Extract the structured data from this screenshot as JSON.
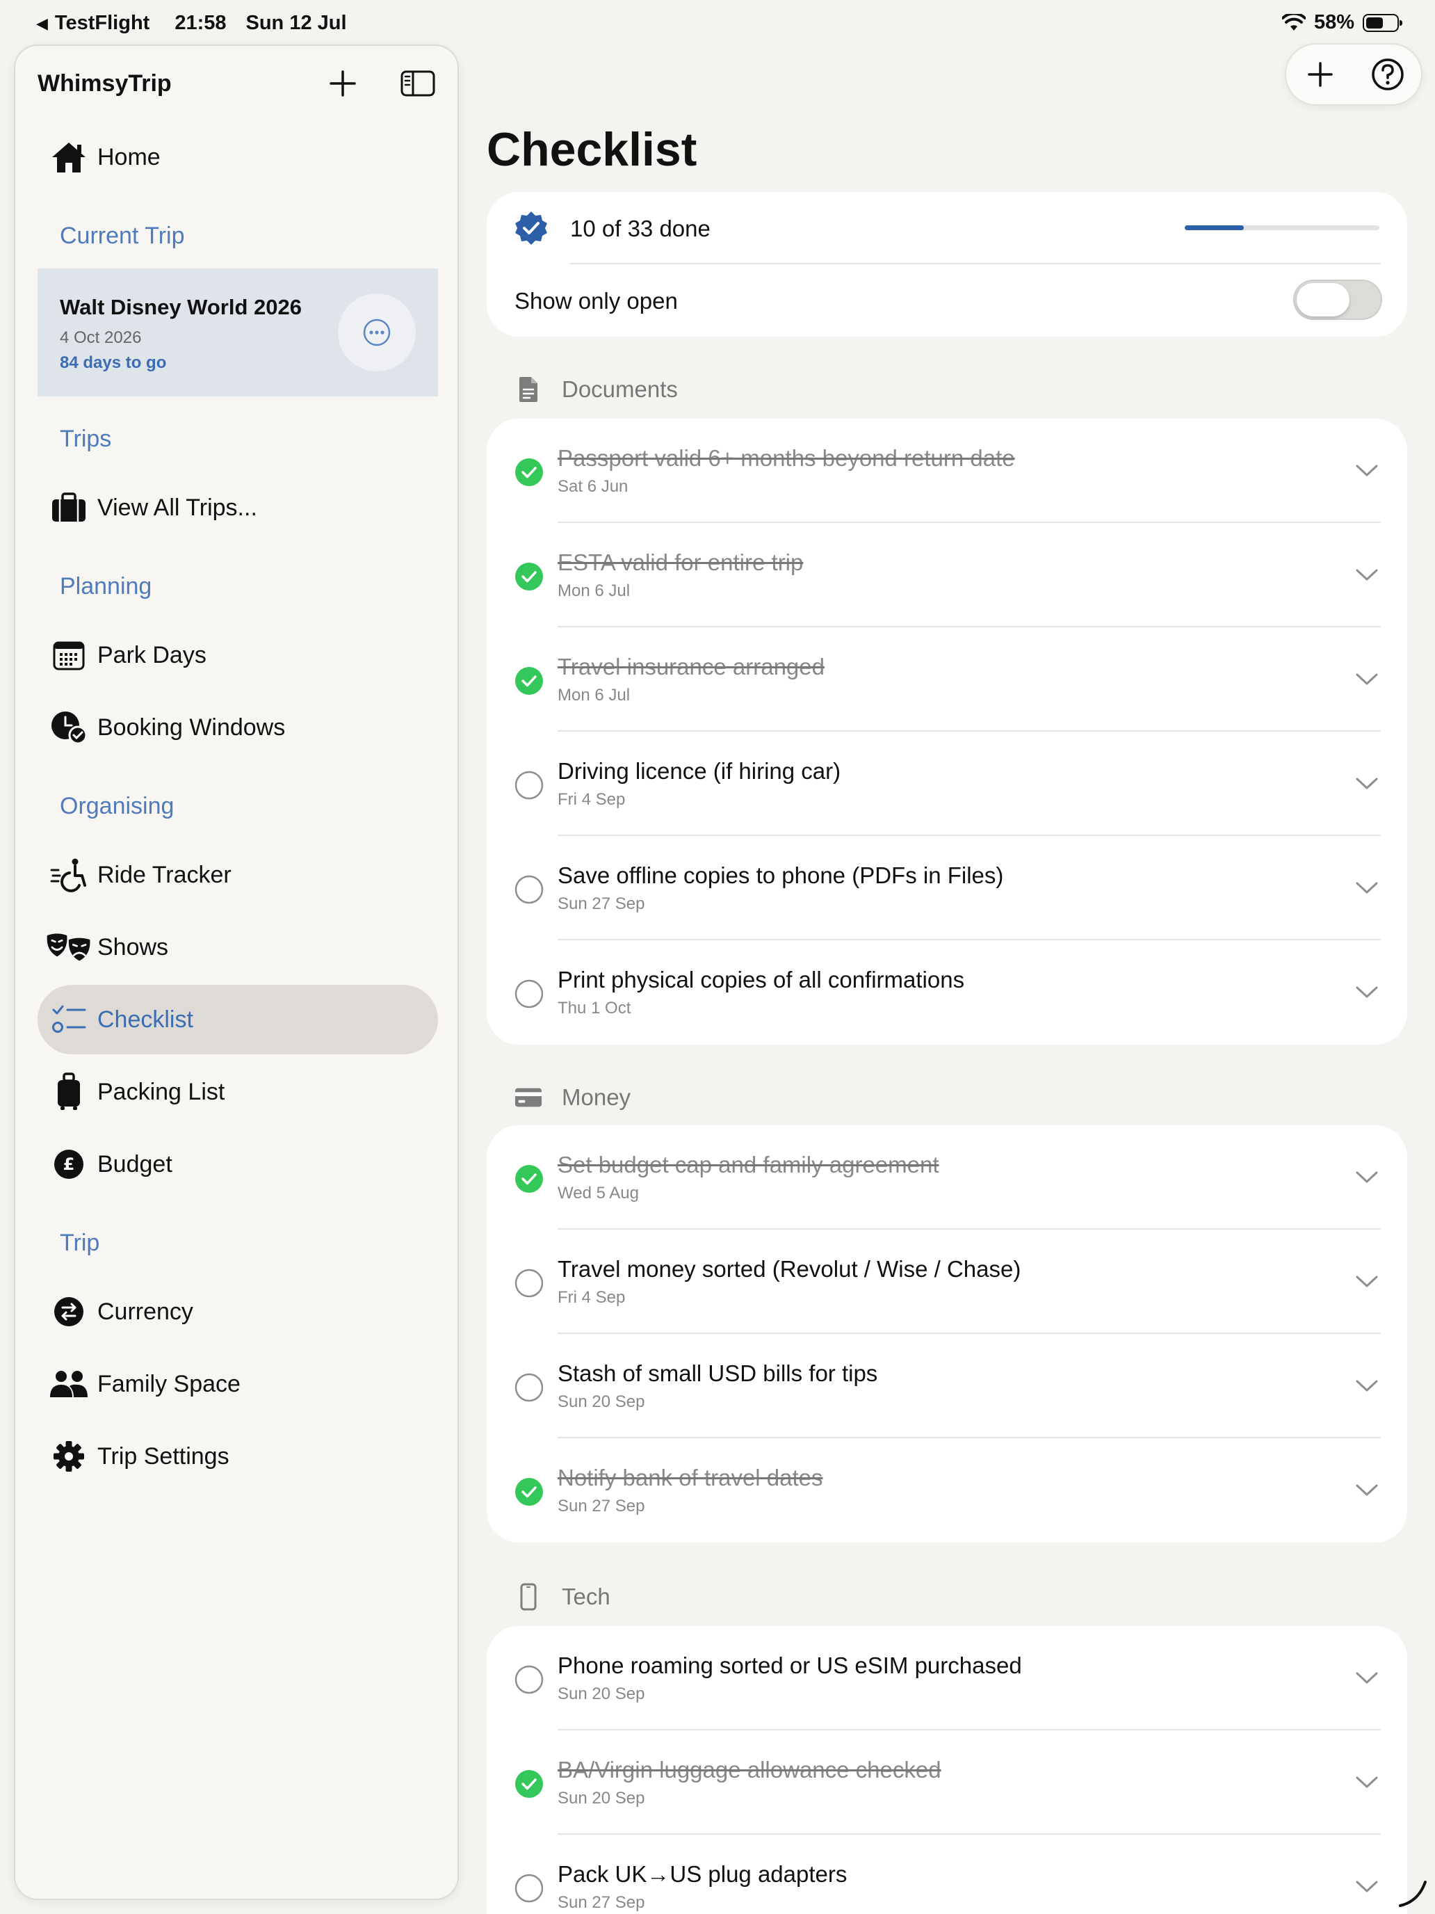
{
  "status_bar": {
    "back_app": "TestFlight",
    "time": "21:58",
    "date": "Sun 12 Jul",
    "battery_text": "58%",
    "battery_level": 0.58
  },
  "sidebar": {
    "app_title": "WhimsyTrip",
    "home": "Home",
    "current_trip_heading": "Current Trip",
    "trip": {
      "name": "Walt Disney World 2026",
      "date": "4 Oct 2026",
      "countdown": "84 days to go"
    },
    "trips_heading": "Trips",
    "view_all_trips": "View All Trips...",
    "planning_heading": "Planning",
    "park_days": "Park Days",
    "booking_windows": "Booking Windows",
    "organising_heading": "Organising",
    "ride_tracker": "Ride Tracker",
    "shows": "Shows",
    "checklist": "Checklist",
    "packing_list": "Packing List",
    "budget": "Budget",
    "trip_heading": "Trip",
    "currency": "Currency",
    "family_space": "Family Space",
    "trip_settings": "Trip Settings"
  },
  "main": {
    "title": "Checklist",
    "progress": {
      "text": "10 of 33 done",
      "done": 10,
      "total": 33,
      "show_only_open_label": "Show only open",
      "show_only_open": false
    },
    "categories": [
      {
        "name": "Documents",
        "icon": "document-icon",
        "items": [
          {
            "title": "Passport valid 6+ months beyond return date",
            "date": "Sat 6 Jun",
            "done": true
          },
          {
            "title": "ESTA valid for entire trip",
            "date": "Mon 6 Jul",
            "done": true
          },
          {
            "title": "Travel insurance arranged",
            "date": "Mon 6 Jul",
            "done": true
          },
          {
            "title": "Driving licence (if hiring car)",
            "date": "Fri 4 Sep",
            "done": false
          },
          {
            "title": "Save offline copies to phone (PDFs in Files)",
            "date": "Sun 27 Sep",
            "done": false
          },
          {
            "title": "Print physical copies of all confirmations",
            "date": "Thu 1 Oct",
            "done": false
          }
        ]
      },
      {
        "name": "Money",
        "icon": "card-icon",
        "items": [
          {
            "title": "Set budget cap and family agreement",
            "date": "Wed 5 Aug",
            "done": true
          },
          {
            "title": "Travel money sorted (Revolut / Wise / Chase)",
            "date": "Fri 4 Sep",
            "done": false
          },
          {
            "title": "Stash of small USD bills for tips",
            "date": "Sun 20 Sep",
            "done": false
          },
          {
            "title": "Notify bank of travel dates",
            "date": "Sun 27 Sep",
            "done": true
          }
        ]
      },
      {
        "name": "Tech",
        "icon": "phone-icon",
        "items": [
          {
            "title": "Phone roaming sorted or US eSIM purchased",
            "date": "Sun 20 Sep",
            "done": false
          },
          {
            "title": "BA/Virgin luggage allowance checked",
            "date": "Sun 20 Sep",
            "done": true
          },
          {
            "title": "Pack UK→US plug adapters",
            "date": "Sun 27 Sep",
            "done": false
          }
        ]
      }
    ]
  },
  "colors": {
    "accent": "#3a6db3",
    "check_green": "#34c759",
    "background": "#f5f3ef",
    "card": "#ffffff"
  }
}
